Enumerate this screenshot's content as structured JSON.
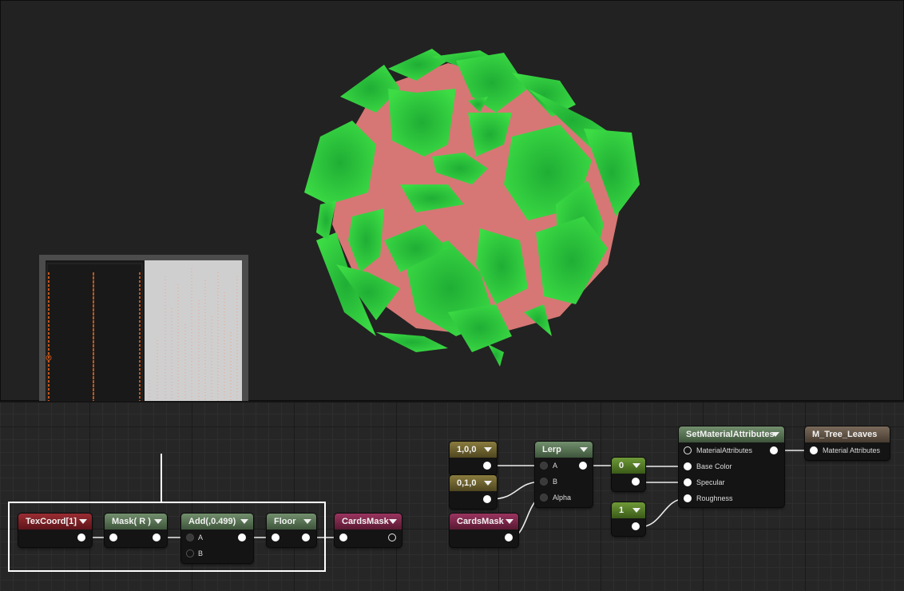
{
  "viewport": {
    "object": "foliage-sphere-preview",
    "colors": {
      "leaves": "#33d63d",
      "inner": "#d97a78",
      "background": "#222222"
    }
  },
  "preview": {
    "label": "texcoord-texture-preview",
    "colors": {
      "dark_half": "#191919",
      "light_half": "#cccccc",
      "lines": "#c2561a",
      "dots": "#f0a08a"
    }
  },
  "nodes": {
    "texcoord": {
      "title": "TexCoord[1]"
    },
    "mask": {
      "title": "Mask( R )"
    },
    "add": {
      "title": "Add(,0.499)",
      "pins": [
        "A",
        "B"
      ]
    },
    "floor": {
      "title": "Floor"
    },
    "cardsmask_out": {
      "title": "CardsMask"
    },
    "const_100": {
      "title": "1,0,0"
    },
    "const_010": {
      "title": "0,1,0"
    },
    "cardsmask_in": {
      "title": "CardsMask"
    },
    "lerp": {
      "title": "Lerp",
      "pins": [
        "A",
        "B",
        "Alpha"
      ]
    },
    "const_0": {
      "title": "0"
    },
    "const_1": {
      "title": "1"
    },
    "setmat": {
      "title": "SetMaterialAttributes",
      "pins": [
        "MaterialAttributes",
        "Base Color",
        "Specular",
        "Roughness"
      ]
    },
    "result": {
      "title": "M_Tree_Leaves",
      "pins": [
        "Material Attributes"
      ]
    }
  },
  "colors": {
    "header_red": "#7a2026",
    "header_green": "#56704f",
    "header_pink": "#7a2548",
    "header_gold": "#6e6230",
    "header_lime": "#557a28",
    "header_brown": "#5f5244",
    "selection_frame": "#ffffff"
  }
}
